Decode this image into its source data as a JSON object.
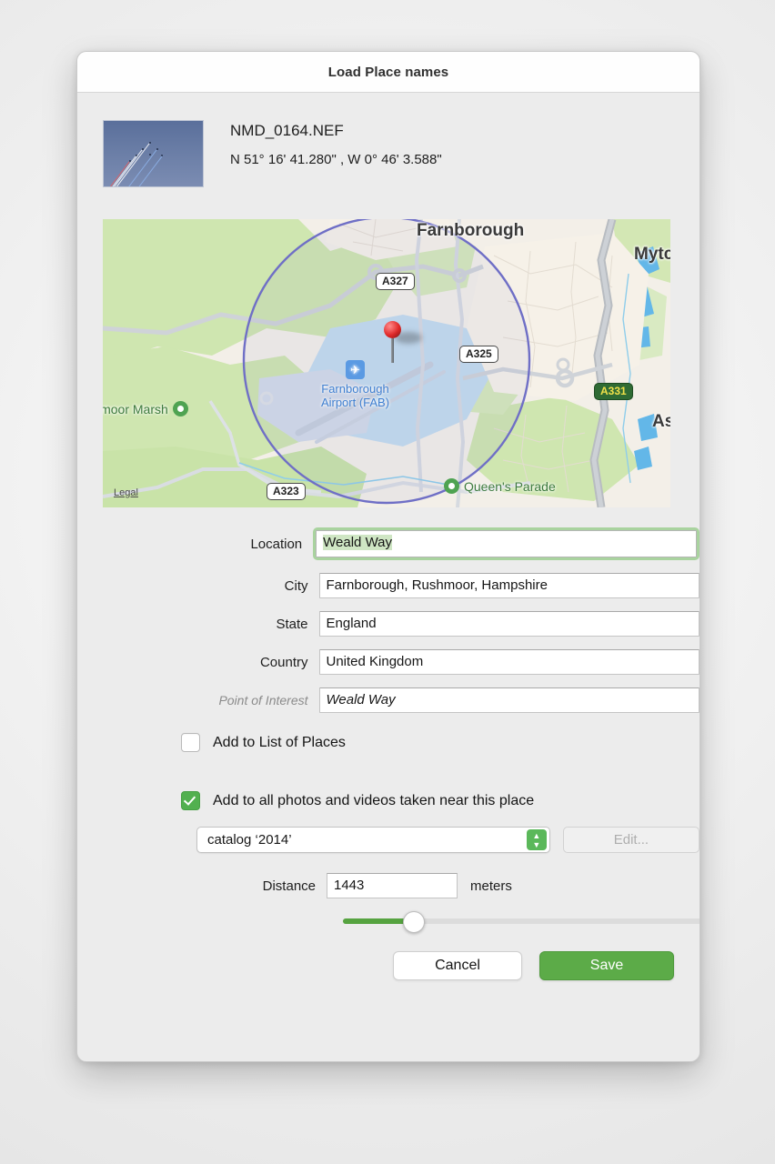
{
  "dialog": {
    "title": "Load Place names"
  },
  "photo": {
    "filename": "NMD_0164.NEF",
    "coordinates": "N 51° 16' 41.280\" , W 0° 46' 3.588\"",
    "thumbnail_alt": "red-arrows-jets-photo"
  },
  "map": {
    "legal_link": "Legal",
    "labels": [
      {
        "text": "Farnborough",
        "kind": "city"
      },
      {
        "text": "Mytc",
        "kind": "city-clipped"
      },
      {
        "text": "As",
        "kind": "city-clipped"
      }
    ],
    "shields": [
      {
        "text": "A327",
        "kind": "a-road"
      },
      {
        "text": "A325",
        "kind": "a-road"
      },
      {
        "text": "A323",
        "kind": "a-road"
      },
      {
        "text": "A331",
        "kind": "motorway"
      }
    ],
    "airport": {
      "line1": "Farnborough",
      "line2": "Airport (FAB)",
      "icon": "airplane-icon"
    },
    "pois": [
      {
        "text": "lmoor Marsh",
        "icon": "park-dot-icon"
      },
      {
        "text": "Queen's Parade",
        "icon": "park-dot-icon"
      }
    ],
    "pin": {
      "icon": "map-pin-icon"
    },
    "radius_circle_color": "#6f6fc6"
  },
  "form": {
    "location": {
      "label": "Location",
      "value": "Weald Way",
      "selected": true
    },
    "city": {
      "label": "City",
      "value": "Farnborough, Rushmoor, Hampshire"
    },
    "state": {
      "label": "State",
      "value": "England"
    },
    "country": {
      "label": "Country",
      "value": "United Kingdom"
    },
    "poi": {
      "label": "Point of Interest",
      "value": "Weald Way"
    }
  },
  "options": {
    "add_to_list": {
      "label": "Add to List of Places",
      "checked": false
    },
    "add_to_all": {
      "label": "Add to all photos and videos taken near this place",
      "checked": true
    },
    "catalog_select": {
      "value": "catalog ‘2014’"
    },
    "edit_button": {
      "label": "Edit...",
      "disabled": true
    },
    "distance": {
      "label": "Distance",
      "value": "1443",
      "unit": "meters",
      "slider_percent": 16
    }
  },
  "footer": {
    "cancel_label": "Cancel",
    "save_label": "Save"
  },
  "colors": {
    "accent_green": "#5cab48",
    "check_green": "#52b04f",
    "focus_ring": "#a9d39f",
    "selection": "#cfe6c4"
  }
}
